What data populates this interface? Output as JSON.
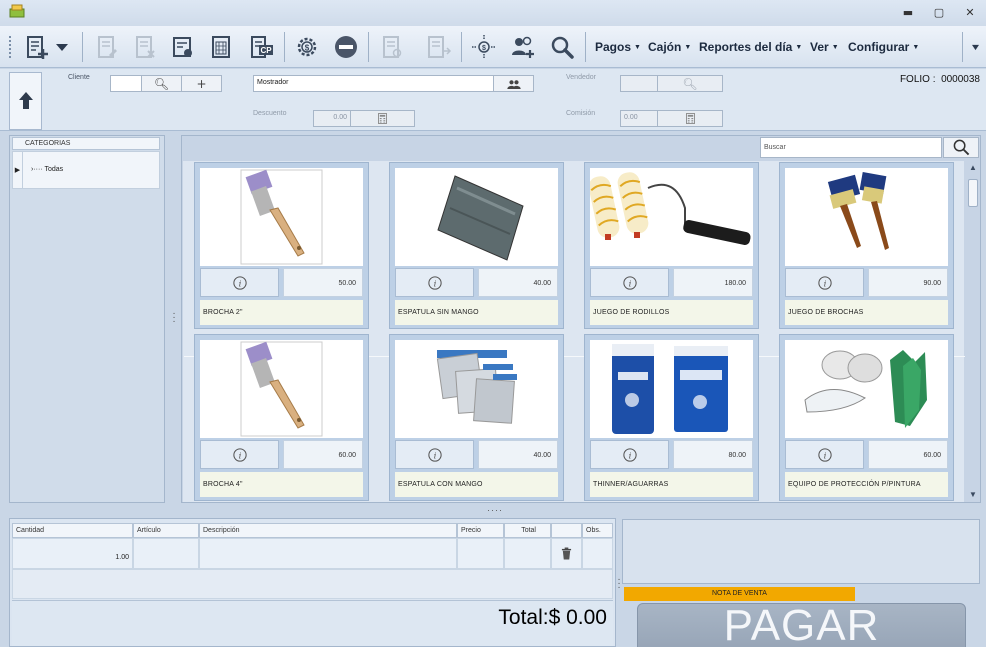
{
  "window": {
    "controls": {
      "minimize": "▬",
      "maximize": "▢",
      "close": "✕"
    }
  },
  "toolbar": {
    "buttons": [
      {
        "icon": "new-ticket-icon",
        "enabled": true
      },
      {
        "icon": "dropdown-arrow-icon",
        "enabled": true
      },
      {
        "icon": "edit-ticket-icon",
        "enabled": false
      },
      {
        "icon": "cancel-ticket-icon",
        "enabled": false
      },
      {
        "icon": "customer-ticket-icon",
        "enabled": false
      },
      {
        "icon": "calculator-doc-icon",
        "enabled": false
      },
      {
        "icon": "cp-doc-icon",
        "enabled": true
      },
      {
        "icon": "cash-gear-icon",
        "enabled": true
      },
      {
        "icon": "remove-circle-icon",
        "enabled": true
      },
      {
        "icon": "ticket-disabled-icon",
        "enabled": false
      },
      {
        "icon": "ticket-arrow-icon",
        "enabled": false
      },
      {
        "icon": "cash-transfer-icon",
        "enabled": true
      },
      {
        "icon": "users-add-icon",
        "enabled": true
      },
      {
        "icon": "magnifier-icon",
        "enabled": true
      }
    ],
    "menus": [
      {
        "label": "Pagos"
      },
      {
        "label": "Cajón"
      },
      {
        "label": "Reportes del día"
      },
      {
        "label": "Ver"
      },
      {
        "label": "Configurar"
      }
    ]
  },
  "header": {
    "cliente_label": "Cliente",
    "cliente_value": "",
    "cliente_name": "Mostrador",
    "vendedor_label": "Vendedor",
    "vendedor_value": "",
    "descuento_label": "Descuento",
    "descuento_value": "0.00",
    "comision_label": "Comisión",
    "comision_value": "0.00",
    "folio_label": "FOLIO :",
    "folio_value": "0000038"
  },
  "categories": {
    "header": "CATEGORIAS",
    "items": [
      {
        "label": "Todas"
      }
    ]
  },
  "search": {
    "placeholder": "Buscar"
  },
  "products": [
    {
      "name": "BROCHA 2\"",
      "price": "50.00",
      "image": "brush-image"
    },
    {
      "name": "ESPATULA SIN MANGO",
      "price": "40.00",
      "image": "spatula-image"
    },
    {
      "name": "JUEGO DE RODILLOS",
      "price": "180.00",
      "image": "rollers-image"
    },
    {
      "name": "JUEGO DE BROCHAS",
      "price": "90.00",
      "image": "brushes-set-image"
    },
    {
      "name": "BROCHA 4\"",
      "price": "60.00",
      "image": "brush-image"
    },
    {
      "name": "ESPATULA CON MANGO",
      "price": "40.00",
      "image": "spatulas-image"
    },
    {
      "name": "THINNER/AGUARRAS",
      "price": "80.00",
      "image": "thinner-cans-image"
    },
    {
      "name": "EQUIPO DE PROTECCIÓN P/PINTURA",
      "price": "60.00",
      "image": "protection-kit-image"
    }
  ],
  "order": {
    "columns": [
      "Cantidad",
      "Artículo",
      "Descripción",
      "Precio",
      "Total",
      "",
      "Obs."
    ],
    "rows": [
      {
        "cantidad": "1.00",
        "articulo": "",
        "descripcion": "",
        "precio": "",
        "total": "",
        "obs": ""
      }
    ],
    "total_text": "Total:$ 0.00"
  },
  "payment": {
    "nota_label": "NOTA DE VENTA",
    "pay_label": "PAGAR"
  },
  "colors": {
    "accent_orange": "#f2a800",
    "panel_blue": "#c9d6e6",
    "pay_button": "#9eacbe"
  }
}
